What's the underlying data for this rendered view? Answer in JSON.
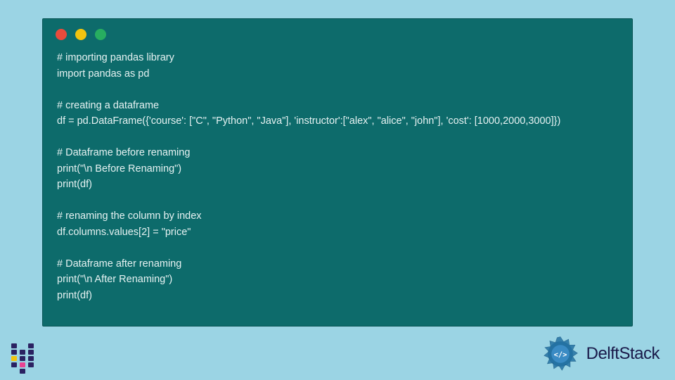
{
  "code": {
    "lines": [
      "# importing pandas library",
      "import pandas as pd",
      "",
      "# creating a dataframe",
      "df = pd.DataFrame({'course': [\"C\", \"Python\", \"Java\"], 'instructor':[\"alex\", \"alice\", \"john\"], 'cost': [1000,2000,3000]})",
      "",
      "# Dataframe before renaming",
      "print(\"\\n Before Renaming\")",
      "print(df)",
      "",
      "# renaming the column by index",
      "df.columns.values[2] = \"price\"",
      "",
      "# Dataframe after renaming",
      "print(\"\\n After Renaming\")",
      "print(df)"
    ]
  },
  "brand": {
    "name": "DelftStack"
  },
  "colors": {
    "bg": "#9bd4e4",
    "window": "#0d6b6b",
    "red": "#e94b3c",
    "yellow": "#f1c40f",
    "green": "#27ae60"
  }
}
